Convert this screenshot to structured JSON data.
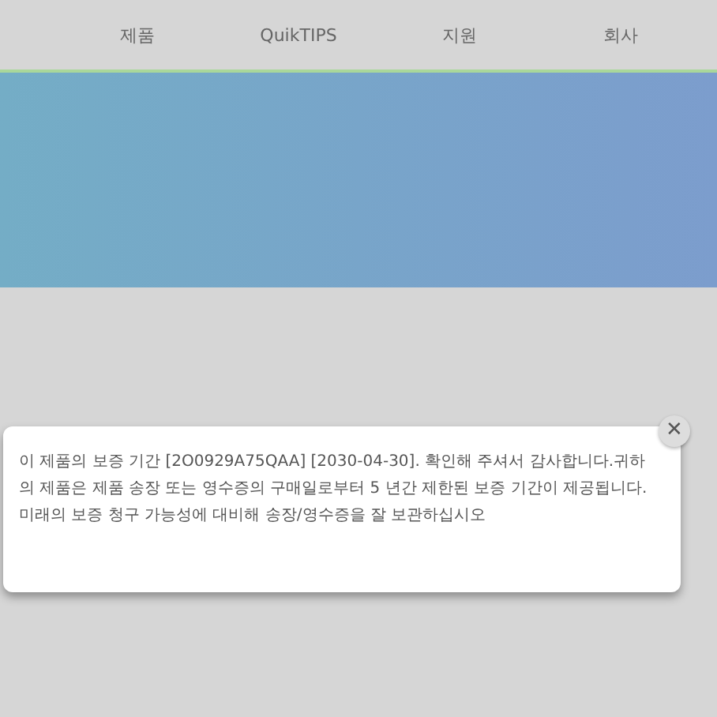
{
  "nav": {
    "items": [
      {
        "label": "제품"
      },
      {
        "label": "QuikTIPS"
      },
      {
        "label": "지원"
      },
      {
        "label": "회사"
      }
    ]
  },
  "dialog": {
    "close": "✕",
    "message": "이 제품의 보증 기간 [2O0929A75QAA] [2030-04-30]. 확인해 주셔서 감사합니다.귀하의 제품은 제품 송장 또는 영수증의 구매일로부터 5 년간 제한된 보증 기간이 제공됩니다. 미래의 보증 청구 가능성에 대비해 송장/영수증을 잘 보관하십시오"
  }
}
